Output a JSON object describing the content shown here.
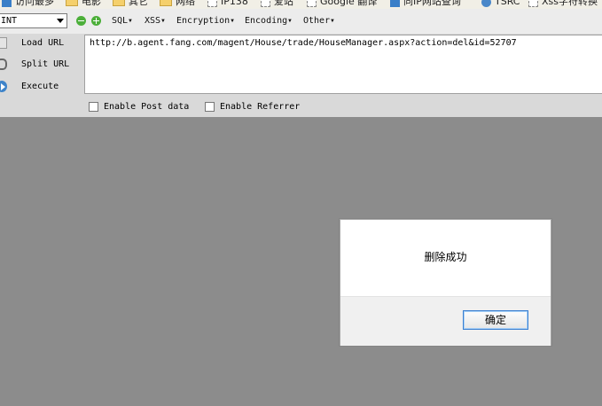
{
  "bookmarks": [
    {
      "label": "访问最多",
      "icon": "chart-icon"
    },
    {
      "label": "电影",
      "icon": "folder-icon"
    },
    {
      "label": "其它",
      "icon": "folder-icon"
    },
    {
      "label": "网络",
      "icon": "folder-icon"
    },
    {
      "label": "IP138",
      "icon": "page-icon"
    },
    {
      "label": "爱站",
      "icon": "page-icon"
    },
    {
      "label": "Google 翻译",
      "icon": "page-icon"
    },
    {
      "label": "同IP网站查询",
      "icon": "chart-icon"
    },
    {
      "label": "TSRC",
      "icon": "globe-icon"
    },
    {
      "label": "Xss字符转换",
      "icon": "page-icon"
    }
  ],
  "hackbar": {
    "select_value": "INT",
    "menus": [
      "SQL",
      "XSS",
      "Encryption",
      "Encoding",
      "Other"
    ],
    "actions": {
      "load": "Load URL",
      "split": "Split URL",
      "execute": "Execute"
    },
    "url": "http://b.agent.fang.com/magent/House/trade/HouseManager.aspx?action=del&id=52707",
    "options": {
      "post": "Enable Post data",
      "referrer": "Enable Referrer"
    }
  },
  "dialog": {
    "message": "删除成功",
    "ok_label": "确定"
  },
  "colors": {
    "page_bg": "#8c8c8c",
    "toolbar_bg": "#ececec",
    "hackbar_bg": "#d9d9d9",
    "button_border": "#3b7fd0"
  }
}
